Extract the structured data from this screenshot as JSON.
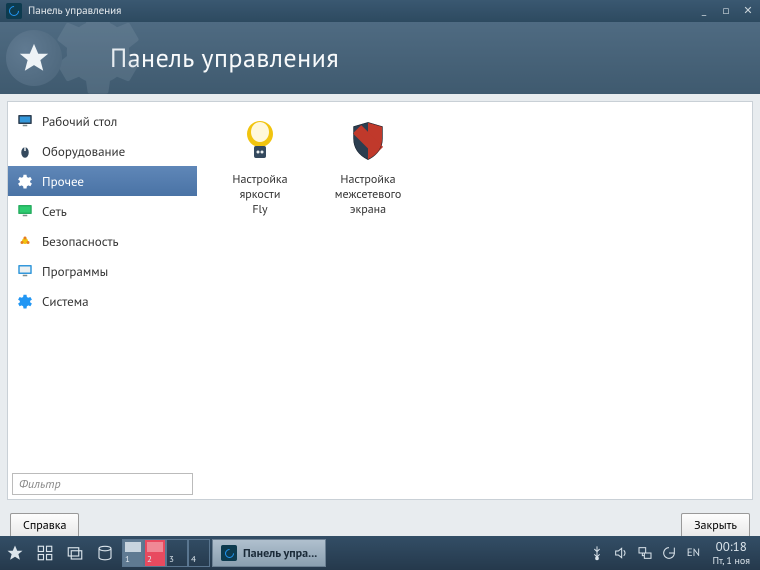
{
  "titlebar": {
    "title": "Панель управления"
  },
  "header": {
    "title": "Панель управления"
  },
  "sidebar": {
    "items": [
      {
        "label": "Рабочий стол",
        "selected": false
      },
      {
        "label": "Оборудование",
        "selected": false
      },
      {
        "label": "Прочее",
        "selected": true
      },
      {
        "label": "Сеть",
        "selected": false
      },
      {
        "label": "Безопасность",
        "selected": false
      },
      {
        "label": "Программы",
        "selected": false
      },
      {
        "label": "Система",
        "selected": false
      }
    ],
    "filter_placeholder": "Фильтр"
  },
  "tiles": [
    {
      "label": "Настройка яркости\nFly",
      "icon": "bulb"
    },
    {
      "label": "Настройка\nмежсетевого\nэкрана",
      "icon": "shield"
    }
  ],
  "buttons": {
    "help": "Справка",
    "close": "Закрыть"
  },
  "taskbar": {
    "workspaces": [
      "1",
      "2",
      "3",
      "4"
    ],
    "active_workspace": 1,
    "task_label": "Панель упра...",
    "lang": "EN",
    "time": "00:18",
    "date": "Пт, 1 ноя"
  }
}
